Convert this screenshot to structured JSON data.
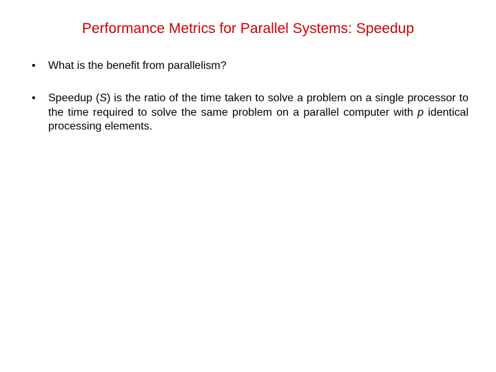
{
  "title": "Performance Metrics for Parallel Systems: Speedup",
  "bullets": [
    {
      "text": "What is the benefit from parallelism?"
    },
    {
      "prefix": "Speedup (",
      "var1": "S",
      "mid1": ") is the ratio of the time taken to solve a problem on a single processor to the time required to solve the same problem on a parallel computer with ",
      "var2": "p",
      "suffix": " identical processing elements."
    }
  ]
}
